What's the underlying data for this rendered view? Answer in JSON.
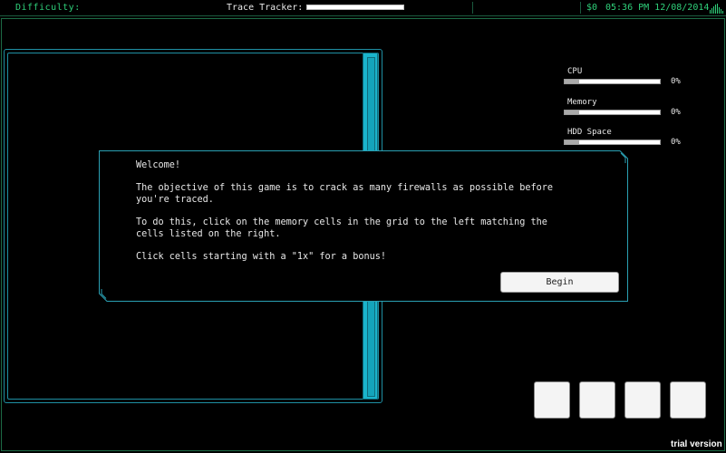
{
  "header": {
    "difficulty_label": "Difficulty:",
    "trace_label": "Trace Tracker:",
    "money": "$0",
    "clock": "05:36 PM 12/08/2014"
  },
  "stats": [
    {
      "label": "CPU",
      "value": "0%"
    },
    {
      "label": "Memory",
      "value": "0%"
    },
    {
      "label": "HDD Space",
      "value": "0%"
    }
  ],
  "dialog": {
    "welcome": "Welcome!",
    "objective": "The objective of this game is to crack as many firewalls as possible before\nyou're traced.",
    "instructions": "To do this, click on the memory cells in the grid to the left matching the\ncells listed on the right.",
    "bonus": "Click cells starting with a \"1x\" for a bonus!",
    "begin_label": "Begin"
  },
  "footer": {
    "trial_label": "trial version"
  },
  "colors": {
    "accent_green": "#2fd07a",
    "accent_cyan": "#1ab4cc",
    "background": "#000000"
  }
}
